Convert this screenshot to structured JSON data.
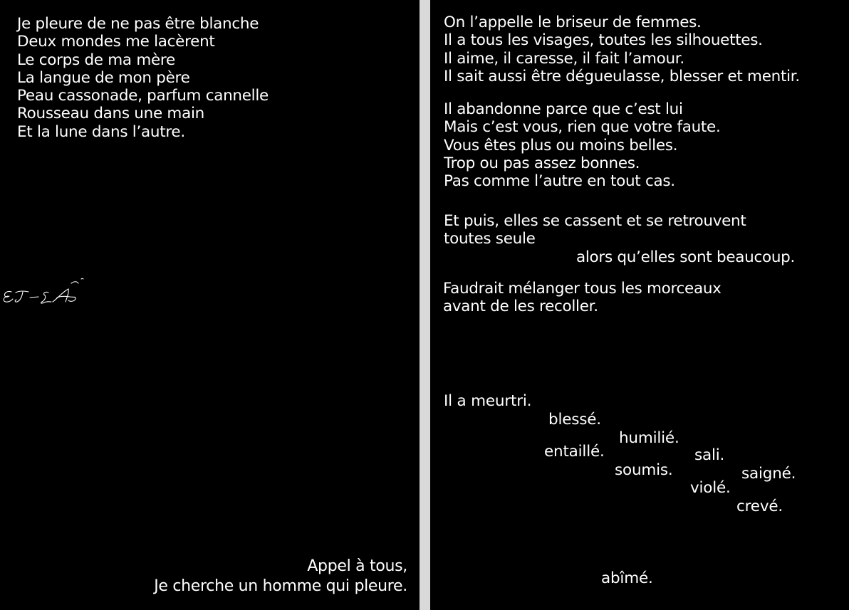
{
  "left_page": {
    "poem_lines": [
      "Je pleure de ne pas être blanche",
      "Deux mondes me lacèrent",
      "Le corps de ma mère",
      "La langue de mon père",
      "Peau cassonade, parfum cannelle",
      "Rousseau dans une main",
      "Et la lune dans l’autre."
    ],
    "signature": "ET-LA",
    "closing_lines": [
      "Appel à tous,",
      "Je cherche un homme qui pleure."
    ]
  },
  "right_page": {
    "stanza1": [
      "On l’appelle le briseur de femmes.",
      "Il a tous les visages, toutes les silhouettes.",
      "Il aime, il caresse, il fait l’amour.",
      "Il sait aussi être dégueulasse, blesser et mentir."
    ],
    "stanza2": [
      "Il abandonne parce que c’est lui",
      "Mais c’est vous, rien que votre faute.",
      "Vous êtes plus ou moins belles.",
      "Trop ou pas assez bonnes.",
      "Pas comme l’autre en tout cas."
    ],
    "stanza3": [
      "Et puis, elles se cassent et se retrouvent",
      "toutes seule",
      "alors qu’elles sont beaucoup."
    ],
    "stanza4": [
      "Faudrait mélanger tous les morceaux",
      "avant de les recoller."
    ],
    "scattered_words": {
      "meurtri": "Il a meurtri.",
      "blesse": "blessé.",
      "humilie": "humilié.",
      "entaille": "entaillé.",
      "sali": "sali.",
      "soumis": "soumis.",
      "saigne": "saigné.",
      "viole": "violé.",
      "creve": "crevé.",
      "abime": "abîmé."
    }
  }
}
